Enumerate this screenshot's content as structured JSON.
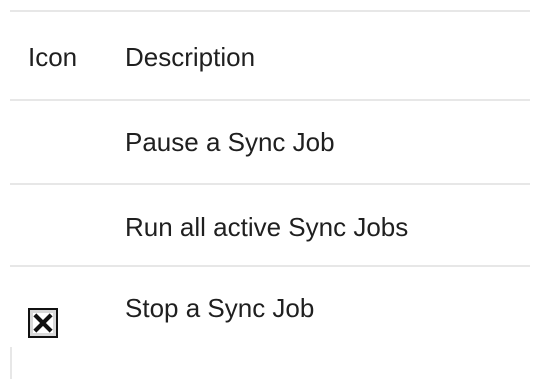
{
  "header": {
    "icon_col": "Icon",
    "description_col": "Description"
  },
  "rows": [
    {
      "icon": "",
      "description": "Pause a Sync Job"
    },
    {
      "icon": "",
      "description": "Run all active Sync Jobs"
    },
    {
      "icon": "stop-x-icon",
      "description": "Stop a Sync Job"
    }
  ],
  "colors": {
    "border": "#e7e7e7",
    "text": "#1f1f1f",
    "icon_fill": "#d9d9d9",
    "icon_stroke": "#111111"
  }
}
